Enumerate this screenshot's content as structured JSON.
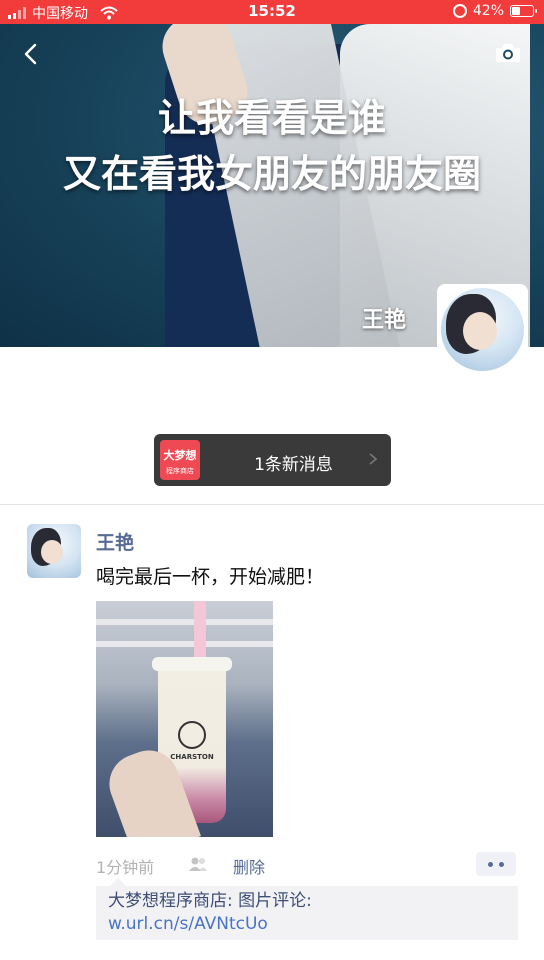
{
  "status_bar": {
    "carrier": "中国移动",
    "time": "15:52",
    "battery": "42%",
    "battery_level": 0.42
  },
  "cover": {
    "caption_line1": "让我看看是谁",
    "caption_line2": "又在看我女朋友的朋友圈",
    "owner_name": "王艳"
  },
  "notification": {
    "thumb_title": "大梦想",
    "thumb_subtitle": "程序商店",
    "text": "1条新消息"
  },
  "post": {
    "author": "王艳",
    "text": "喝完最后一杯，开始减肥！",
    "image_brand": "CHARSTON",
    "time": "1分钟前",
    "delete_label": "删除",
    "comment": {
      "author": "大梦想程序商店",
      "separator": ": ",
      "text": "图片评论:",
      "link": "w.url.cn/s/AVNtcUo"
    }
  },
  "icons": [
    "back-icon",
    "camera-icon",
    "signal-icon",
    "wifi-icon",
    "rotation-lock-icon",
    "battery-icon",
    "chevron-right-icon",
    "privacy-icon",
    "more-icon"
  ],
  "colors": {
    "status_bar": "#f23b3b",
    "link_blue": "#576b95",
    "notify_bg": "#3a3a3a",
    "thumb_red": "#ef4a54"
  }
}
